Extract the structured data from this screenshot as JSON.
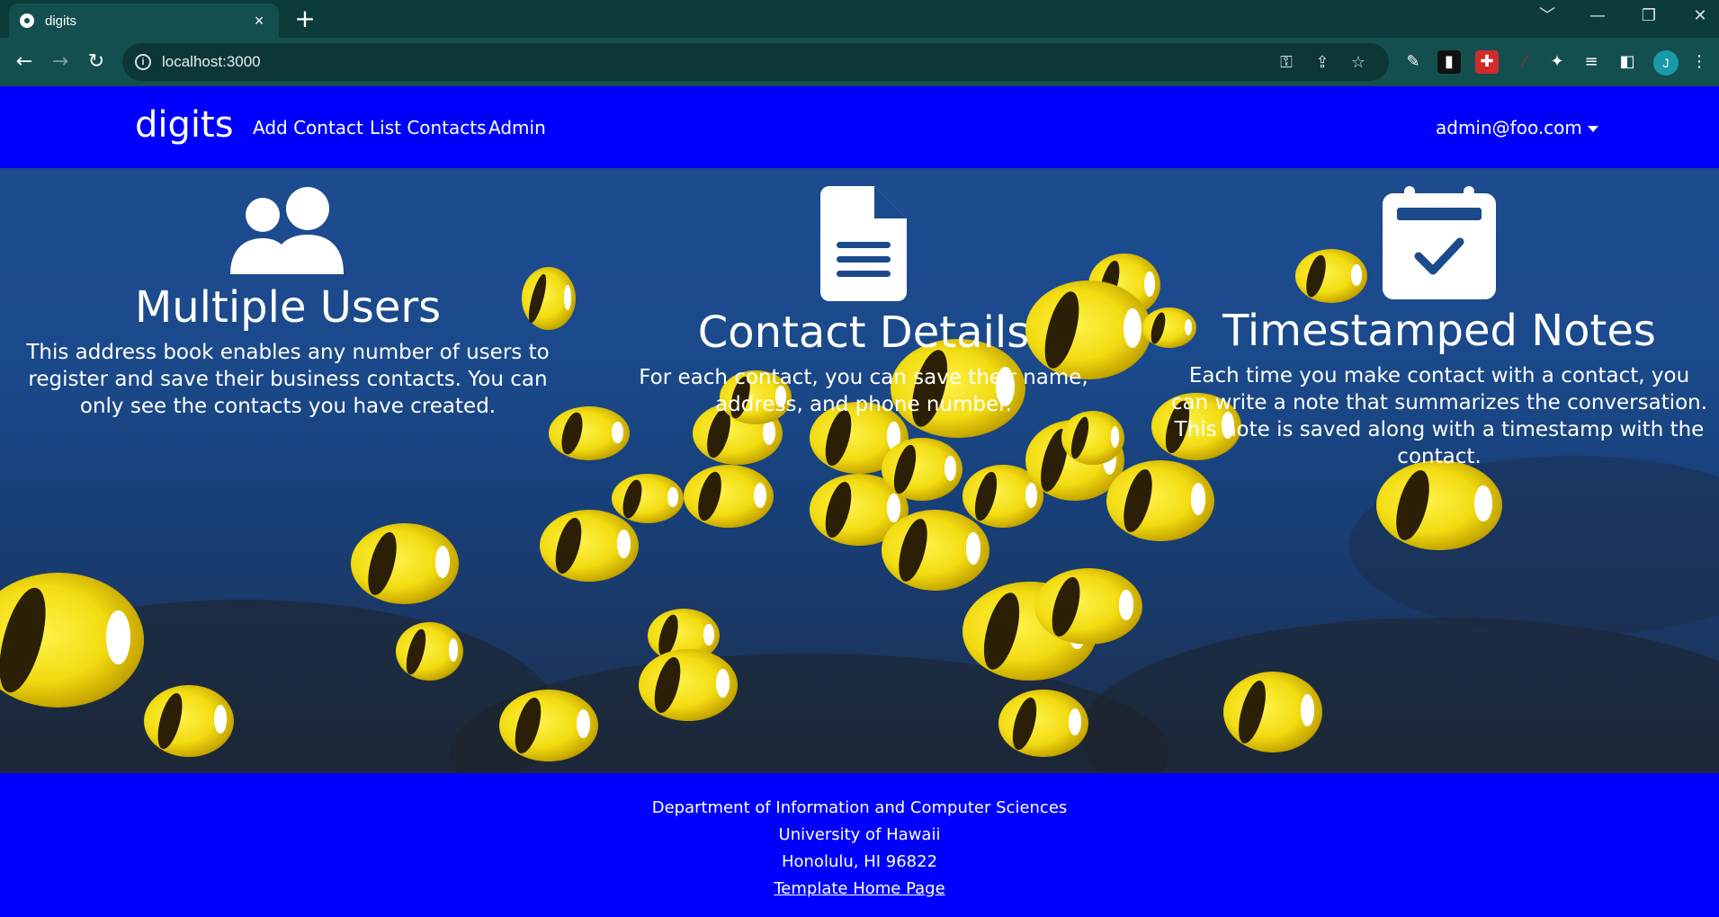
{
  "browser": {
    "tab_title": "digits",
    "tab_close": "×",
    "new_tab": "+",
    "url": "localhost:3000",
    "profile_initial": "J",
    "window_controls": [
      "﹀",
      "—",
      "❐",
      "✕"
    ]
  },
  "navbar": {
    "brand": "digits",
    "links": [
      "Add Contact",
      "List Contacts",
      "Admin"
    ],
    "user": "admin@foo.com"
  },
  "features": [
    {
      "icon": "users-icon",
      "title": "Multiple Users",
      "text": "This address book enables any number of users to register and save their business contacts. You can only see the contacts you have created."
    },
    {
      "icon": "file-lines-icon",
      "title": "Contact Details",
      "text": "For each contact, you can save their name, address, and phone number."
    },
    {
      "icon": "calendar-check-icon",
      "title": "Timestamped Notes",
      "text": "Each time you make contact with a contact, you can write a note that summarizes the conversation. This note is saved along with a timestamp with the contact."
    }
  ],
  "footer": {
    "line1": "Department of Information and Computer Sciences",
    "line2": "University of Hawaii",
    "line3": "Honolulu, HI 96822",
    "link": "Template Home Page"
  },
  "colors": {
    "navbar": "#0000ff",
    "footer": "#0000ff",
    "chrome": "#144f4f"
  }
}
